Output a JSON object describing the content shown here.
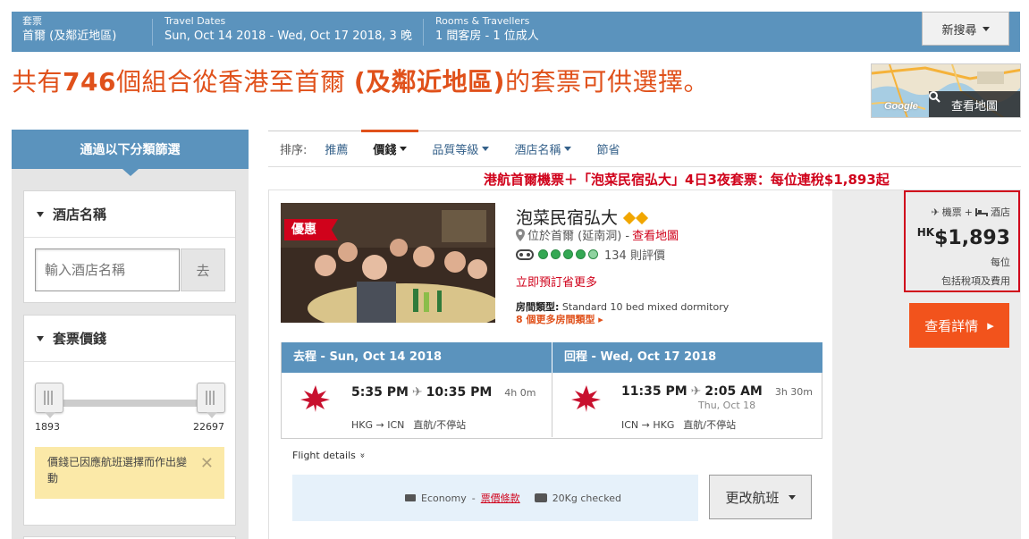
{
  "search": {
    "dest_label": "套票",
    "dest_value": "首爾 (及鄰近地區)",
    "dates_label": "Travel Dates",
    "dates_value": "Sun, Oct 14 2018 - Wed, Oct 17 2018, 3 晚",
    "rooms_label": "Rooms & Travellers",
    "rooms_value": "1 間客房 - 1 位成人",
    "new_search": "新搜尋"
  },
  "headline": {
    "prefix": "共有",
    "count": "746",
    "middle": "個組合從香港至首爾 ",
    "dest": "(及鄰近地區)",
    "suffix": "的套票可供選擇。"
  },
  "map": {
    "provider": "Google",
    "view_label": "查看地圖"
  },
  "sidebar": {
    "title": "通過以下分類篩選",
    "hotel_panel_title": "酒店名稱",
    "hotel_placeholder": "輸入酒店名稱",
    "go_label": "去",
    "price_panel_title": "套票價錢",
    "price_min": "1893",
    "price_max": "22697",
    "notice": "價錢已因應航班選擇而作出變動",
    "notice_close": "✕"
  },
  "sort": {
    "label": "排序:",
    "items": [
      {
        "label": "推薦"
      },
      {
        "label": "價錢"
      },
      {
        "label": "品質等級"
      },
      {
        "label": "酒店名稱"
      },
      {
        "label": "節省"
      }
    ]
  },
  "package_title": "港航首爾機票＋「泡菜民宿弘大」4日3夜套票：每位連稅$1,893起",
  "hotel": {
    "ribbon": "優惠",
    "name": "泡菜民宿弘大",
    "location": "位於首爾 (延南洞) - ",
    "map_link": "查看地圖",
    "reviews": "134 則評價",
    "promo": "立即預訂省更多",
    "room_type_label": "房間類型:",
    "room_type_value": " Standard 10 bed mixed dormitory",
    "more_rooms": "8 個更多房間類型 ▸"
  },
  "price": {
    "combo_flight": "機票",
    "combo_plus": "+",
    "combo_hotel": "酒店",
    "currency": "HK",
    "amount": "$1,893",
    "per": "每位",
    "includes": "包括稅項及費用",
    "details_button": "查看詳情",
    "details_arrow": "▸"
  },
  "flights": {
    "outbound": {
      "header": "去程 - Sun, Oct 14 2018",
      "depart": "5:35 PM",
      "arrive": "10:35 PM",
      "duration": "4h 0m",
      "route": "HKG → ICN",
      "stops": "直航/不停站"
    },
    "return": {
      "header": "回程 - Wed, Oct 17 2018",
      "depart": "11:35 PM",
      "arrive": "2:05 AM",
      "duration": "3h 30m",
      "next_day": "Thu, Oct 18",
      "route": "ICN → HKG",
      "stops": "直航/不停站"
    },
    "airline_en": "HONGKONG AIRLINES",
    "airline_zh": "香港航空",
    "details_label": "Flight details",
    "details_chevron": "»",
    "cabin": "Economy",
    "cabin_sep": " - ",
    "fare_rules": "票價條款",
    "baggage": "20Kg checked",
    "change_button": "更改航班"
  },
  "colors": {
    "header_blue": "#5b93bd",
    "accent_orange": "#e0511b",
    "brand_red": "#d0021b",
    "cta_orange": "#f2531c"
  }
}
